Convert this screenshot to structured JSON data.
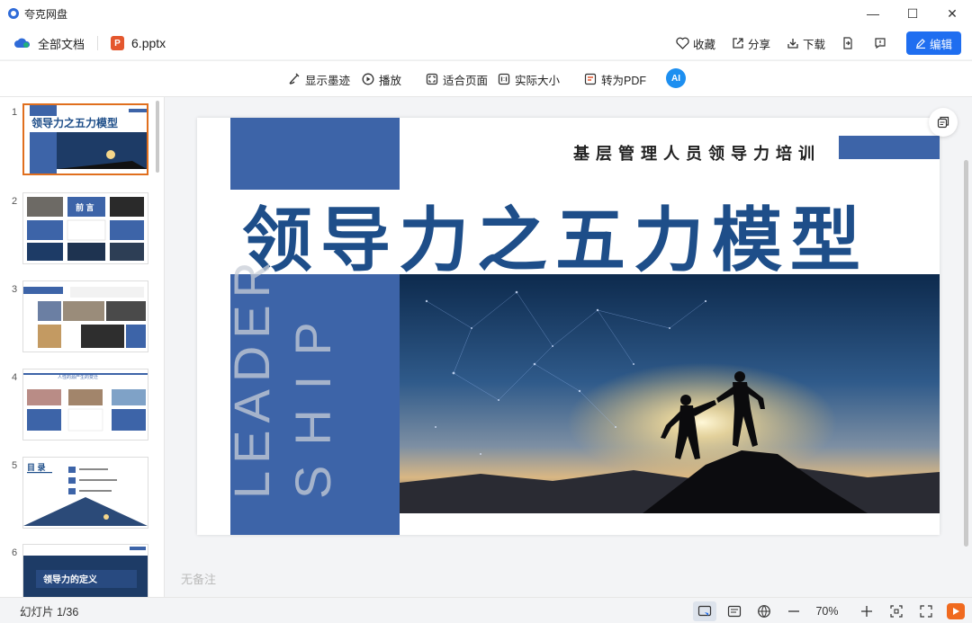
{
  "app": {
    "title": "夸克网盘"
  },
  "window": {
    "minimize": "—",
    "maximize": "☐",
    "close": "✕"
  },
  "topbar": {
    "all_docs": "全部文档",
    "file_name": "6.pptx",
    "file_badge": "P",
    "actions": {
      "favorite": "收藏",
      "share": "分享",
      "download": "下载",
      "edit": "编辑"
    }
  },
  "toolbar": {
    "show_ink": "显示墨迹",
    "play": "播放",
    "fit_page": "适合页面",
    "actual_size": "实际大小",
    "to_pdf": "转为PDF",
    "ai_badge": "AI"
  },
  "thumbnails": [
    {
      "num": "1",
      "text": "领导力之五力模型"
    },
    {
      "num": "2",
      "text": "前  言"
    },
    {
      "num": "3",
      "text": ""
    },
    {
      "num": "4",
      "text": "人性的源产生的变迁"
    },
    {
      "num": "5",
      "text": "目 录"
    },
    {
      "num": "6",
      "text": "领导力的定义"
    }
  ],
  "slide": {
    "subtitle": "基层管理人员领导力培训",
    "title": "领导力之五力模型",
    "vertical_1": "LEADER",
    "vertical_2": "SHIP"
  },
  "notes": {
    "placeholder": "无备注"
  },
  "status": {
    "slide_count": "幻灯片 1/36",
    "zoom": "70%"
  },
  "colors": {
    "accent": "#1f6ef0",
    "slide_blue": "#3d64a8",
    "title_blue": "#1e4e89",
    "active_thumb": "#e06f1e"
  }
}
